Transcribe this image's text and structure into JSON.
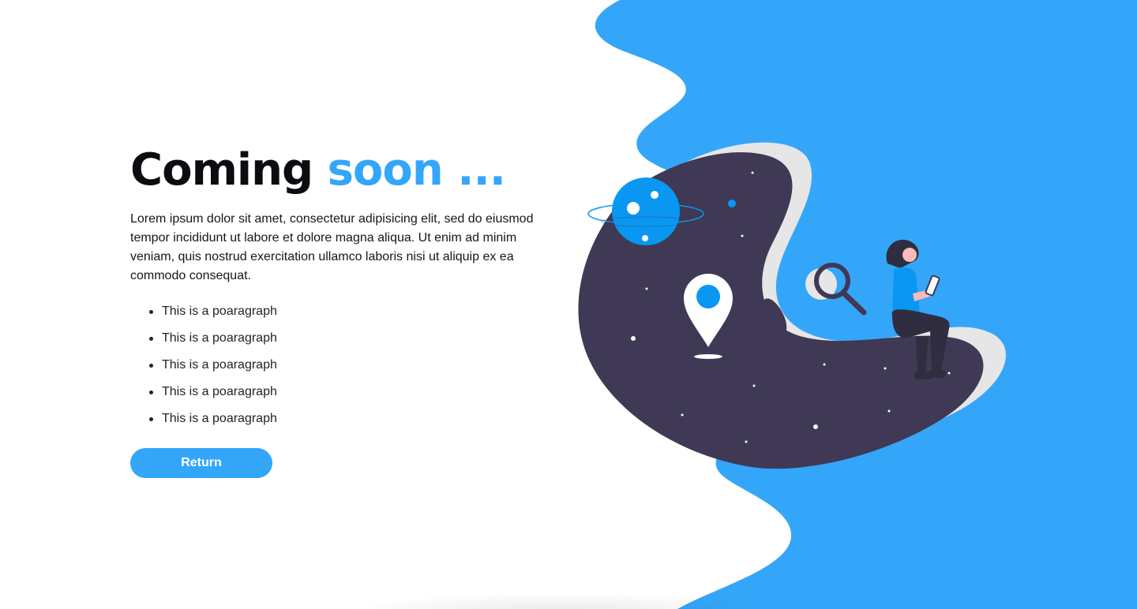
{
  "hero": {
    "title_main": "Coming",
    "title_accent": "soon ...",
    "description": "Lorem ipsum dolor sit amet, consectetur adipisicing elit, sed do eiusmod tempor incididunt ut labore et dolore magna aliqua. Ut enim ad minim veniam, quis nostrud exercitation ullamco laboris nisi ut aliquip ex ea commodo consequat.",
    "bullets": [
      "This is a poaragraph",
      "This is a poaragraph",
      "This is a poaragraph",
      "This is a poaragraph",
      "This is a poaragraph"
    ],
    "button_label": "Return"
  },
  "colors": {
    "accent": "#34a6fa",
    "dark_blob": "#3f3955",
    "light_blob": "#e6e6e6",
    "text": "#0b0b10"
  },
  "illustration": {
    "icons": [
      "planet-icon",
      "map-pin-icon",
      "magnifier-icon",
      "person-with-phone"
    ]
  }
}
